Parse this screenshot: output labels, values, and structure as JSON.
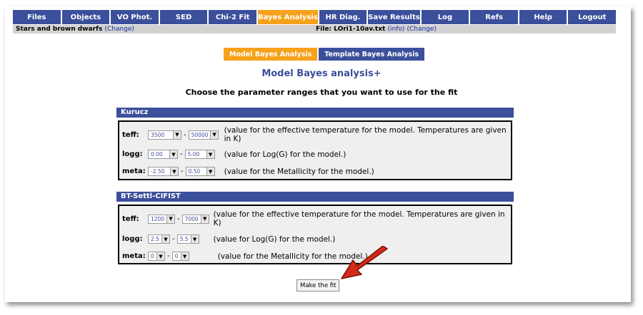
{
  "nav": {
    "items": [
      {
        "label": "Files"
      },
      {
        "label": "Objects"
      },
      {
        "label": "VO Phot."
      },
      {
        "label": "SED"
      },
      {
        "label": "Chi-2 Fit"
      },
      {
        "label": "Bayes Analysis",
        "active": true
      },
      {
        "label": "HR Diag."
      },
      {
        "label": "Save Results"
      },
      {
        "label": "Log"
      },
      {
        "label": "Refs"
      },
      {
        "label": "Help"
      },
      {
        "label": "Logout"
      }
    ],
    "active_color": "#f6a11a",
    "color": "#3b4f9b"
  },
  "infobar": {
    "category": "Stars and brown dwarfs",
    "change_label": "(Change)",
    "file_prefix": "File: LOri1-10av.txt",
    "info_label": "(info)",
    "file_change_label": "(Change)"
  },
  "subtabs": {
    "model": "Model Bayes Analysis",
    "template": "Template Bayes Analysis"
  },
  "page": {
    "title": "Model Bayes analysis+",
    "subtitle": "Choose the parameter ranges that you want to use for the fit"
  },
  "kurucz": {
    "header": "Kurucz",
    "teff": {
      "label": "teff:",
      "min": "3500",
      "max": "50000",
      "desc": "(value for the effective temperature for the model. Temperatures are given in K)"
    },
    "logg": {
      "label": "logg:",
      "min": "0.00",
      "max": "5.00",
      "desc": "(value for Log(G) for the model.)"
    },
    "meta": {
      "label": "meta:",
      "min": "-2.50",
      "max": "0.50",
      "desc": "(value for the Metallicity for the model.)"
    }
  },
  "btsettl": {
    "header": "BT-Settl-CIFIST",
    "teff": {
      "label": "teff:",
      "min": "1200",
      "max": "7000",
      "desc": "(value for the effective temperature for the model. Temperatures are given in K)"
    },
    "logg": {
      "label": "logg:",
      "min": "2.5",
      "max": "5.5",
      "desc": "(value for Log(G) for the model.)"
    },
    "meta": {
      "label": "meta:",
      "min": "0",
      "max": "0",
      "desc": "(value for the Metallicity for the model.)"
    }
  },
  "actions": {
    "fit_label": "Make the fit"
  },
  "icons": {
    "dropdown": "chevron-down-icon",
    "pointer": "red-arrow-icon"
  }
}
